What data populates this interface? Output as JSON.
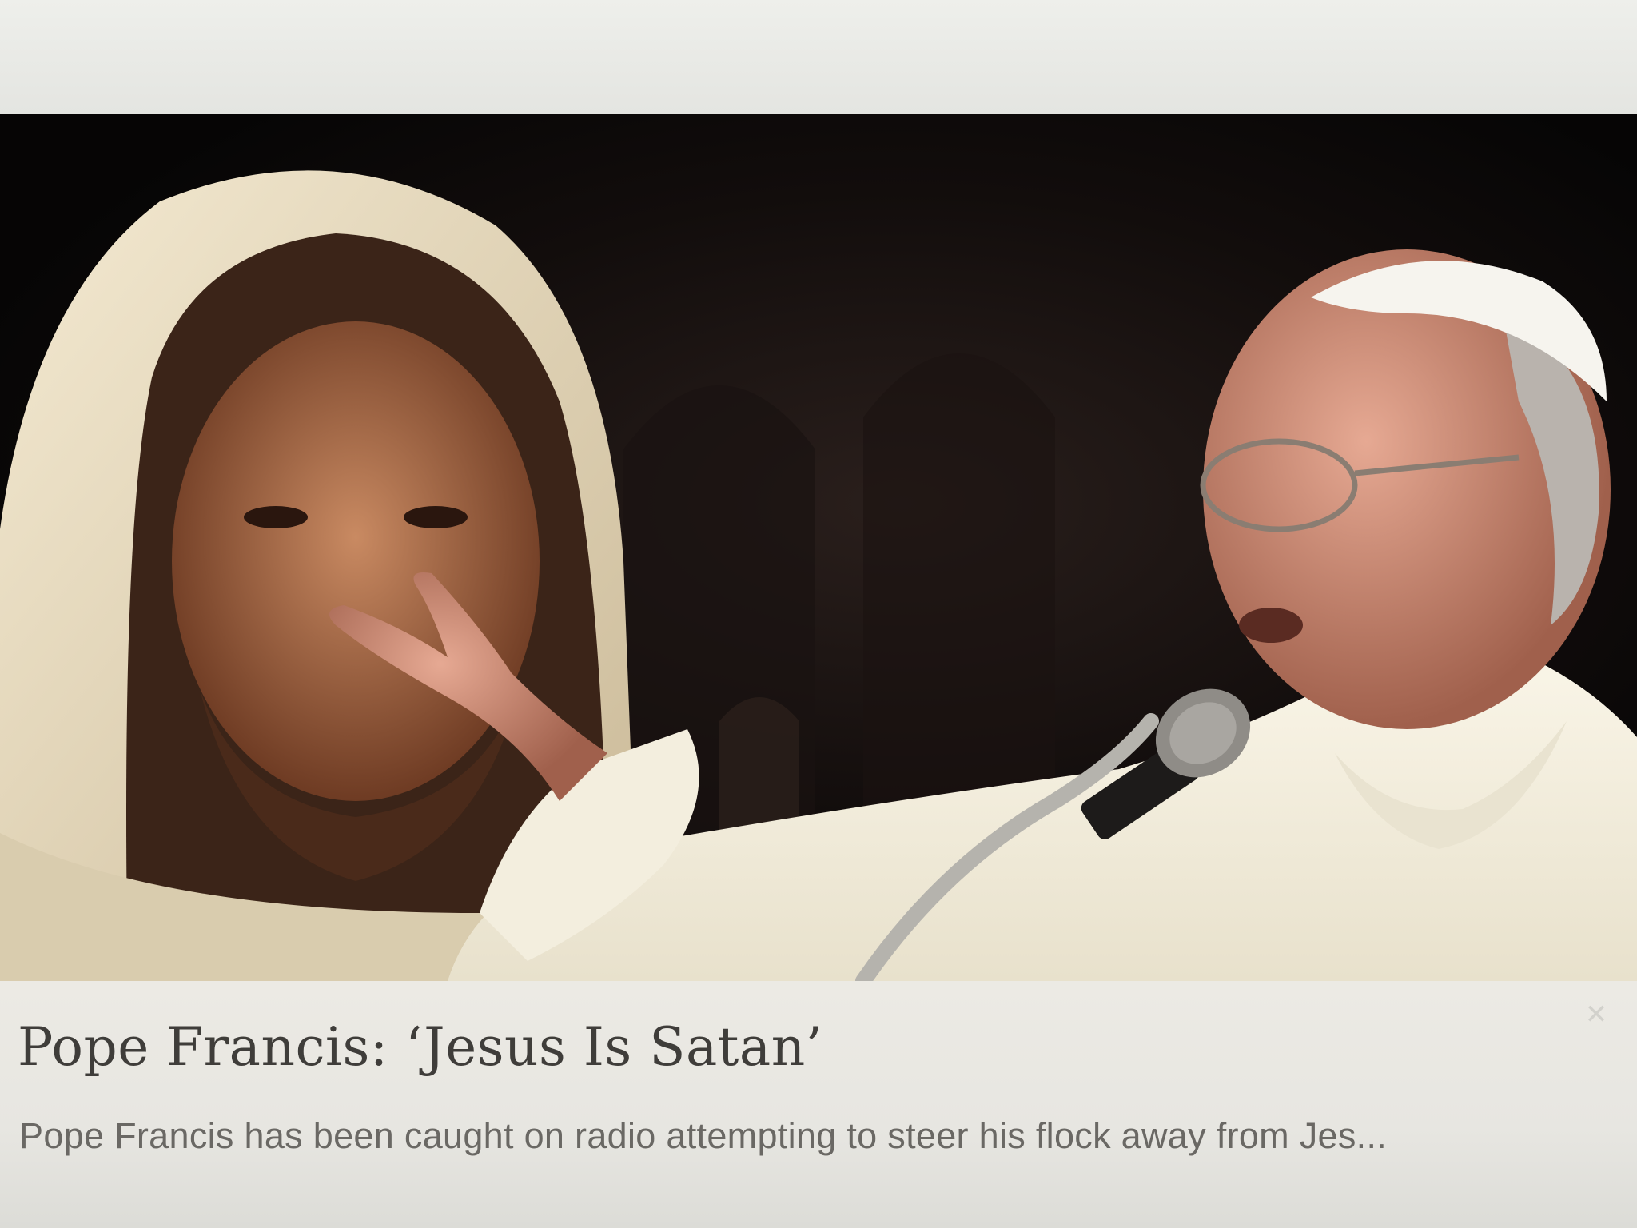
{
  "article": {
    "headline": "Pope Francis: ‘Jesus Is Satan’",
    "snippet": "Pope Francis has been caught on radio attempting to steer his flock away from Jes..."
  },
  "icons": {
    "close": "close-icon",
    "close_glyph": "✕"
  },
  "colors": {
    "image_background": "#0b0909",
    "card_background": "#e9e8e3",
    "headline_text": "#3f3d3a",
    "snippet_text": "#6a6864"
  }
}
